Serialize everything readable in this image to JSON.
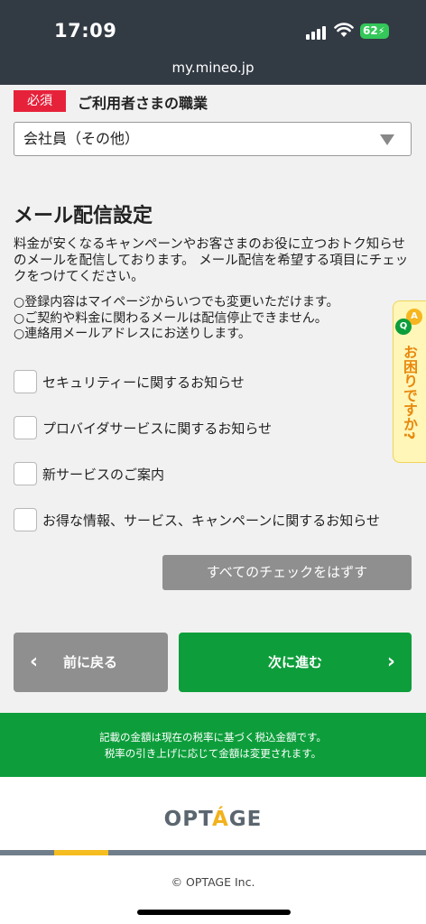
{
  "status_bar": {
    "time": "17:09",
    "battery": "62",
    "url": "my.mineo.jp"
  },
  "occupation": {
    "badge": "必須",
    "label": "ご利用者さまの職業",
    "selected": "会社員（その他）"
  },
  "mail_settings": {
    "title": "メール配信設定",
    "description": "料金が安くなるキャンペーンやお客さまのお役に立つおトク知らせのメールを配信しております。 メール配信を希望する項目にチェックをつけてください。",
    "notes": [
      "○登録内容はマイページからいつでも変更いただけます。",
      "○ご契約や料金に関わるメールは配信停止できません。",
      "○連絡用メールアドレスにお送りします。"
    ],
    "options": [
      {
        "label": "セキュリティーに関するお知らせ",
        "checked": false
      },
      {
        "label": "プロバイダサービスに関するお知らせ",
        "checked": false
      },
      {
        "label": "新サービスのご案内",
        "checked": false
      },
      {
        "label": "お得な情報、サービス、キャンペーンに関するお知らせ",
        "checked": false
      }
    ],
    "uncheck_all_label": "すべてのチェックをはずす"
  },
  "nav": {
    "back_label": "前に戻る",
    "next_label": "次に進む"
  },
  "tax_notice": {
    "line1": "記載の金額は現在の税率に基づく税込金額です。",
    "line2": "税率の引き上げに応じて金額は変更されます。"
  },
  "footer": {
    "logo_pre": "OPT",
    "logo_accent": "Á",
    "logo_post": "GE",
    "copyright": "© OPTAGE Inc."
  },
  "help_tab": {
    "icon_a": "A",
    "icon_q": "Q",
    "text": "お困りですか?"
  },
  "colors": {
    "green": "#0d9e3b",
    "red": "#e6223a",
    "gray_button": "#8f8f8f",
    "header": "#323a44"
  }
}
